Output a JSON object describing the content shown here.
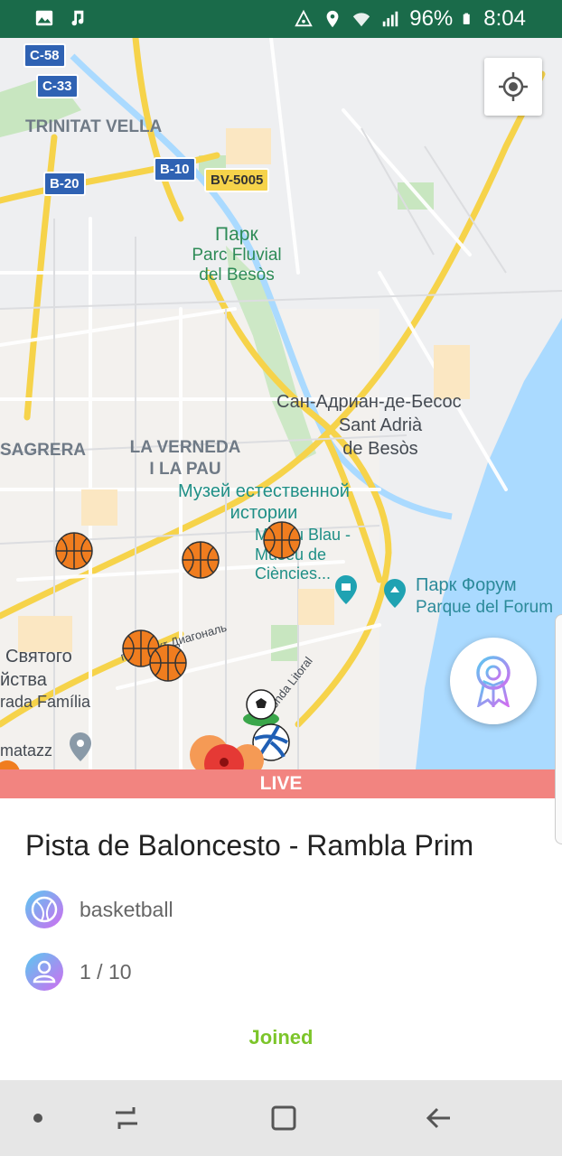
{
  "status_bar": {
    "battery": "96%",
    "time": "8:04",
    "icons": [
      "image-icon",
      "music-icon",
      "data-saver-icon",
      "location-icon",
      "wifi-icon",
      "signal-icon",
      "battery-icon"
    ]
  },
  "map": {
    "road_badges": [
      "C-58",
      "C-33",
      "B-20",
      "B-10",
      "BV-5005"
    ],
    "labels": {
      "trinitat": "TRINITAT VELLA",
      "park_ru": "Парк",
      "park_name": "Parc Fluvial del Besòs",
      "san_adrian_ru": "Сан-Адриан-де-Бесос",
      "sant_adria": "Sant Adrià de Besòs",
      "sagrera": "SAGRERA",
      "verneda": "LA VERNEDA I LA PAU",
      "museum_ru": "Музей естественной истории",
      "museum_ca": "Museu Blau - Museu de Ciències...",
      "forum_ru": "Парк Форум",
      "forum_es": "Parque del Forum",
      "sagrada_1": "Святого",
      "sagrada_2": "йства",
      "sagrada_3": "rada Família",
      "avenue": "проспект Диагональ",
      "ronda": "Ronda Litoral",
      "matazz": "matazz"
    },
    "markers": [
      "basketball",
      "basketball",
      "basketball",
      "basketball",
      "basketball",
      "soccer",
      "volleyball",
      "live-pin"
    ],
    "colors": {
      "water": "#aadaff",
      "park": "#c8e6c0",
      "road_major": "#f6d34a",
      "road_minor": "#ffffff"
    }
  },
  "live_label": "LIVE",
  "court": {
    "title": "Pista de Baloncesto - Rambla Prim",
    "sport": "basketball",
    "players": "1 / 10",
    "status": "Joined"
  },
  "colors": {
    "status_bar": "#1a6b4a",
    "live": "#f28480",
    "joined": "#7cc52a"
  }
}
